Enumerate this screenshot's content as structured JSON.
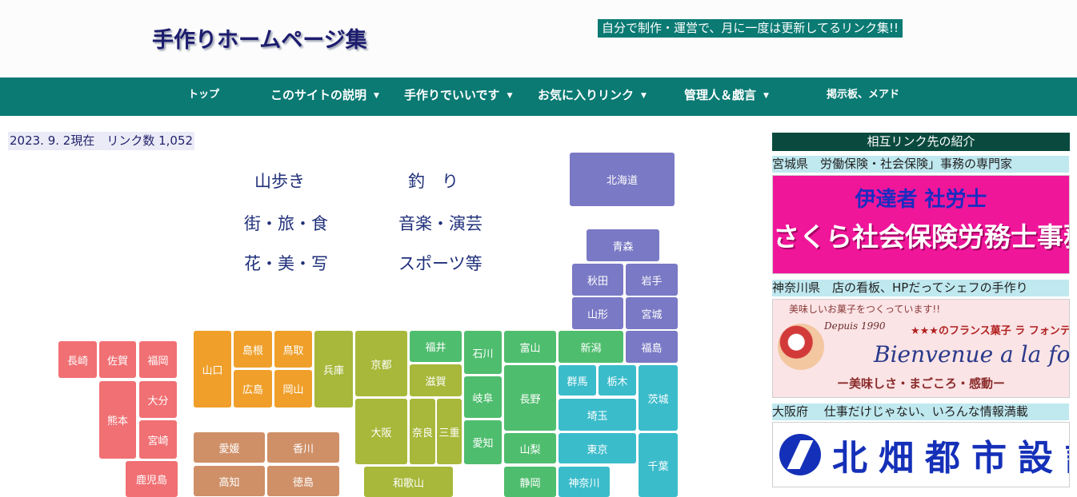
{
  "header": {
    "title": "手作りホームページ集",
    "tagline": "自分で制作・運営で、月に一度は更新してるリンク集!!"
  },
  "nav": {
    "items": [
      {
        "label": "トップ",
        "dropdown": false
      },
      {
        "label": "このサイトの説明",
        "dropdown": true
      },
      {
        "label": "手作りでいいです",
        "dropdown": true
      },
      {
        "label": "お気に入りリンク",
        "dropdown": true
      },
      {
        "label": "管理人＆戯言",
        "dropdown": true
      },
      {
        "label": "掲示板、メアド",
        "dropdown": false
      }
    ],
    "caret": "▼"
  },
  "status": "2023. 9. 2現在　リンク数 1,052",
  "categories": [
    "山歩き",
    "釣　り",
    "街・旅・食",
    "音楽・演芸",
    "花・美・写",
    "スポーツ等"
  ],
  "map_colors": {
    "hokkaido_tohoku": "#7a79c5",
    "kanto": "#3bbccb",
    "chubu": "#4fbd6e",
    "kinki": "#a7b83a",
    "chugoku": "#ef9f2a",
    "shikoku": "#cf9068",
    "kyushu": "#f07074"
  },
  "prefectures": {
    "hokkaido": "北海道",
    "aomori": "青森",
    "akita": "秋田",
    "iwate": "岩手",
    "yamagata": "山形",
    "miyagi": "宮城",
    "fukushima": "福島",
    "niigata": "新潟",
    "toyama": "富山",
    "ishikawa": "石川",
    "fukui": "福井",
    "gunma": "群馬",
    "tochigi": "栃木",
    "ibaraki": "茨城",
    "nagano": "長野",
    "gifu": "岐阜",
    "saitama": "埼玉",
    "tokyo": "東京",
    "chiba": "千葉",
    "yamanashi": "山梨",
    "aichi": "愛知",
    "shizuoka": "静岡",
    "kanagawa": "神奈川",
    "kyoto": "京都",
    "shiga": "滋賀",
    "osaka": "大阪",
    "nara": "奈良",
    "mie": "三重",
    "wakayama": "和歌山",
    "hyogo": "兵庫",
    "shimane": "島根",
    "tottori": "鳥取",
    "hiroshima": "広島",
    "okayama": "岡山",
    "yamaguchi": "山口",
    "ehime": "愛媛",
    "kagawa": "香川",
    "kochi": "高知",
    "tokushima": "徳島",
    "nagasaki": "長崎",
    "saga": "佐賀",
    "fukuoka": "福岡",
    "oita": "大分",
    "kumamoto": "熊本",
    "miyazaki": "宮崎",
    "kagoshima": "鹿児島"
  },
  "sidebar": {
    "title": "相互リンク先の紹介",
    "entries": [
      {
        "label": "宮城県　労働保険・社会保険」事務の専門家",
        "banner_line1": "伊達者 社労士",
        "banner_line2": "さくら社会保険労務士事務所・宮城"
      },
      {
        "label": "神奈川県　店の看板、HPだってシェフの手作り",
        "banner_line1": "美味しいお菓子をつくっています!!",
        "banner_line2": "Depuis 1990",
        "banner_line3": "★★★のフランス菓子 ラ フォンティーヌ",
        "banner_line4": "Bienvenue a la fontaine",
        "banner_line5": "ー美味しさ・まごころ・感動ー"
      },
      {
        "label": "大阪府　 仕事だけじゃない、いろんな情報満載",
        "banner_line1": "北畑都市設計"
      }
    ]
  }
}
